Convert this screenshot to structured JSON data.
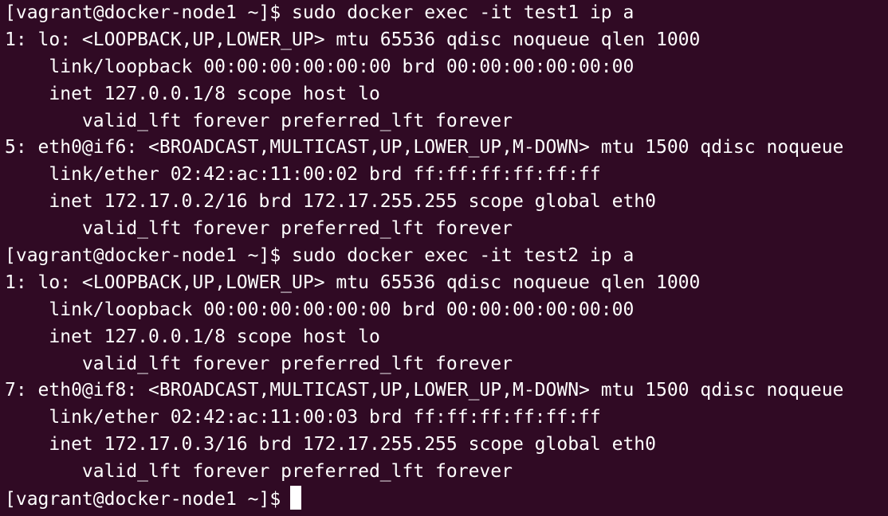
{
  "terminal": {
    "background": "#300a24",
    "foreground": "#ffffff",
    "lines": [
      "[vagrant@docker-node1 ~]$ sudo docker exec -it test1 ip a",
      "1: lo: <LOOPBACK,UP,LOWER_UP> mtu 65536 qdisc noqueue qlen 1000",
      "    link/loopback 00:00:00:00:00:00 brd 00:00:00:00:00:00",
      "    inet 127.0.0.1/8 scope host lo",
      "       valid_lft forever preferred_lft forever",
      "5: eth0@if6: <BROADCAST,MULTICAST,UP,LOWER_UP,M-DOWN> mtu 1500 qdisc noqueue",
      "    link/ether 02:42:ac:11:00:02 brd ff:ff:ff:ff:ff:ff",
      "    inet 172.17.0.2/16 brd 172.17.255.255 scope global eth0",
      "       valid_lft forever preferred_lft forever",
      "[vagrant@docker-node1 ~]$ sudo docker exec -it test2 ip a",
      "1: lo: <LOOPBACK,UP,LOWER_UP> mtu 65536 qdisc noqueue qlen 1000",
      "    link/loopback 00:00:00:00:00:00 brd 00:00:00:00:00:00",
      "    inet 127.0.0.1/8 scope host lo",
      "       valid_lft forever preferred_lft forever",
      "7: eth0@if8: <BROADCAST,MULTICAST,UP,LOWER_UP,M-DOWN> mtu 1500 qdisc noqueue",
      "    link/ether 02:42:ac:11:00:03 brd ff:ff:ff:ff:ff:ff",
      "    inet 172.17.0.3/16 brd 172.17.255.255 scope global eth0",
      "       valid_lft forever preferred_lft forever"
    ],
    "prompt": "[vagrant@docker-node1 ~]$"
  }
}
